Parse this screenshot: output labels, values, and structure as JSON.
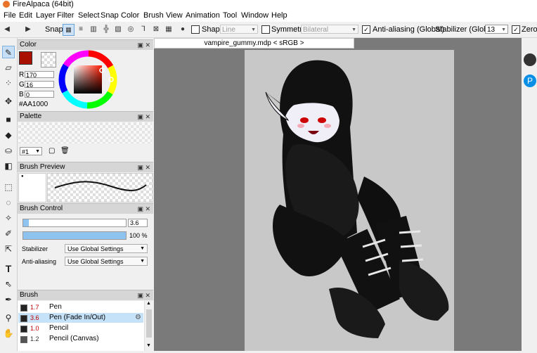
{
  "window": {
    "title": "FireAlpaca (64bit)"
  },
  "menu": [
    "File",
    "Edit",
    "Layer",
    "Filter",
    "Select",
    "Snap",
    "Color",
    "Brush",
    "View",
    "Animation",
    "Tool",
    "Window",
    "Help"
  ],
  "toolbar": {
    "snap_label": "Snap",
    "shape_label": "Shape",
    "shape_value": "Line",
    "symmetry_label": "Symmetry",
    "symmetry_value": "Bilateral",
    "antialias_label": "Anti-aliasing (Global)",
    "stabilizer_label": "Stabilizer (Global)",
    "stabilizer_value": "13",
    "zero_label": "Zero I"
  },
  "document": {
    "tab_label": "vampire_gummy.mdp < sRGB >"
  },
  "color_panel": {
    "title": "Color",
    "r": "170",
    "g": "16",
    "b": "0",
    "hex": "#AA1000",
    "primary_color": "#aa1000"
  },
  "palette_panel": {
    "title": "Palette",
    "selector": "#1"
  },
  "brush_preview_panel": {
    "title": "Brush Preview"
  },
  "brush_control_panel": {
    "title": "Brush Control",
    "size": "3.6",
    "opacity": "100 %",
    "opacity_fraction": 1.0,
    "stabilizer_label": "Stabilizer",
    "stabilizer_value": "Use Global Settings",
    "antialias_label": "Anti-aliasing",
    "antialias_value": "Use Global Settings"
  },
  "brush_panel": {
    "title": "Brush",
    "items": [
      {
        "size": "1.7",
        "name": "Pen"
      },
      {
        "size": "3.6",
        "name": "Pen (Fade In/Out)"
      },
      {
        "size": "1.0",
        "name": "Pencil"
      },
      {
        "size": "1.2",
        "name": "Pencil (Canvas)"
      }
    ]
  },
  "icons": [
    "brush-icon",
    "eraser-icon",
    "dot-icon",
    "move-icon",
    "fill-rect-icon",
    "lasso-icon",
    "bucket-icon",
    "gradient-icon",
    "select-rect-icon",
    "lasso-select-icon",
    "magic-wand-icon",
    "select-pen-icon",
    "select-eraser-icon",
    "text-icon",
    "select-icon",
    "eyedropper-icon",
    "hand-icon"
  ]
}
